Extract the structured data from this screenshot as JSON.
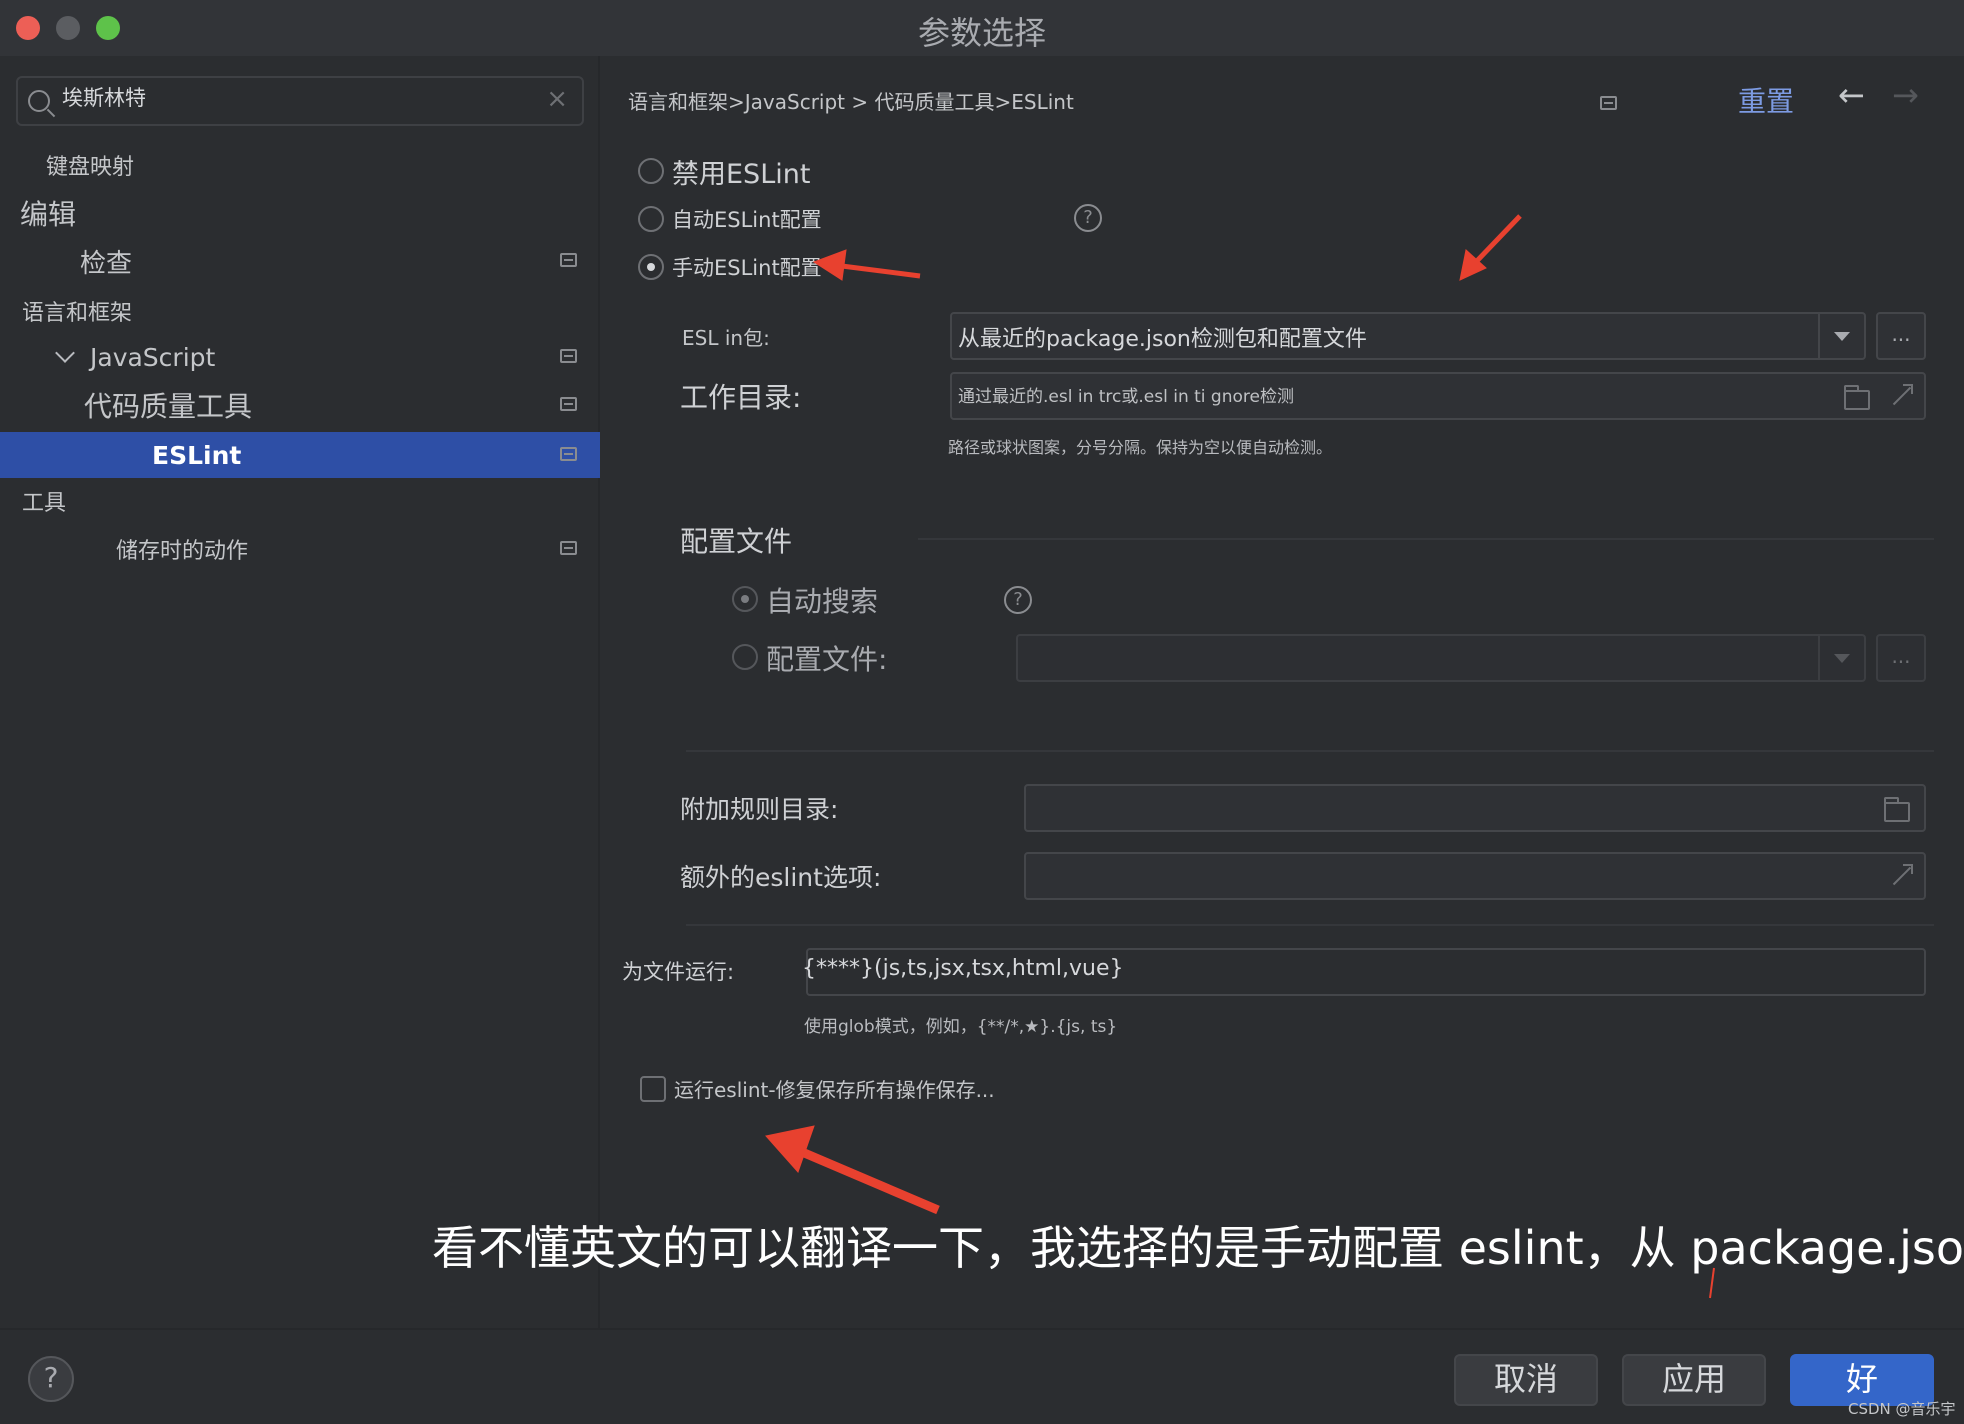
{
  "window": {
    "title": "参数选择"
  },
  "sidebar": {
    "search_value": "埃斯林特",
    "items": [
      {
        "label": "键盘映射"
      },
      {
        "label": "编辑"
      },
      {
        "label": "检查"
      },
      {
        "label": "语言和框架"
      },
      {
        "label": "JavaScript"
      },
      {
        "label": "代码质量工具"
      },
      {
        "label": "ESLint"
      },
      {
        "label": "工具"
      },
      {
        "label": "储存时的动作"
      }
    ]
  },
  "header": {
    "breadcrumb": "语言和框架>JavaScript > 代码质量工具>ESLint",
    "reset_label": "重置",
    "back_arrow": "←",
    "forward_arrow": "→"
  },
  "mode": {
    "disable_label": "禁用ESLint",
    "auto_label": "自动ESLint配置",
    "manual_label": "手动ESLint配置",
    "selected": "manual"
  },
  "package": {
    "label": "ESL in包:",
    "value": "从最近的package.json检测包和配置文件",
    "dots": "..."
  },
  "workdir": {
    "label": "工作目录:",
    "value": "通过最近的.esl in trc或.esl in ti gnore检测",
    "hint": "路径或球状图案，分号分隔。保持为空以便自动检测。"
  },
  "config": {
    "section_title": "配置文件",
    "auto_search_label": "自动搜索",
    "config_file_label": "配置文件:",
    "dots": "..."
  },
  "extra": {
    "rules_dir_label": "附加规则目录:",
    "eslint_options_label": "额外的eslint选项:"
  },
  "run_for_files": {
    "label": "为文件运行:",
    "value": "{****}(js,ts,jsx,tsx,html,vue}",
    "hint": "使用glob模式，例如，{**/*,★}.{js, ts}"
  },
  "fix_on_save": {
    "label": "运行eslint-修复保存所有操作保存..."
  },
  "caption": {
    "text": "看不懂英文的可以翻译一下，我选择的是手动配置 eslint，从 package.json"
  },
  "footer": {
    "help": "?",
    "cancel_label": "取消",
    "apply_label": "应用",
    "ok_label": "好",
    "watermark": "CSDN @音乐宇"
  },
  "colors": {
    "selection": "#2e4fa6",
    "link": "#7d9be3",
    "annotation_arrow": "#e8412f",
    "primary_button": "#3466c9"
  }
}
